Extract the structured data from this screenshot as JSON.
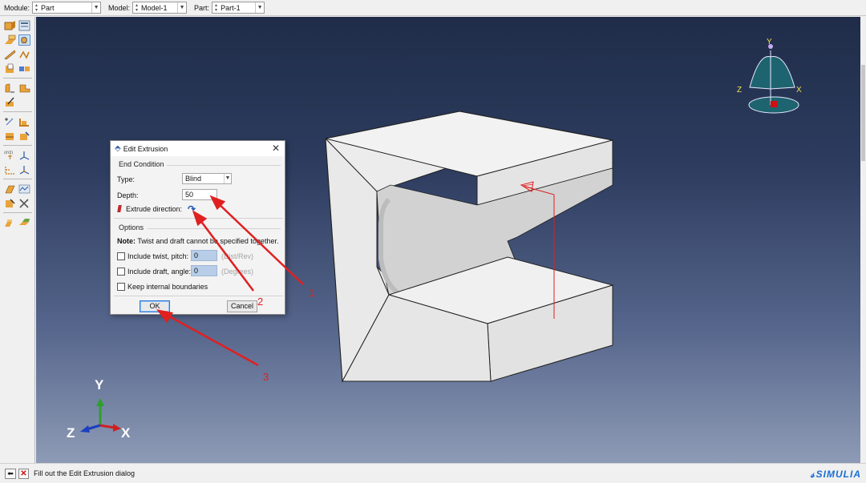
{
  "context_bar": {
    "module_label": "Module:",
    "module_value": "Part",
    "model_label": "Model:",
    "model_value": "Model-1",
    "part_label": "Part:",
    "part_value": "Part-1"
  },
  "dialog": {
    "title": "Edit Extrusion",
    "end_condition_group": "End Condition",
    "type_label": "Type:",
    "type_value": "Blind",
    "depth_label": "Depth:",
    "depth_value": "50",
    "extrude_direction_label": "Extrude direction:",
    "options_group": "Options",
    "note_bold": "Note:",
    "note_text": "Twist and draft cannot be specified together.",
    "twist_label": "Include twist, pitch:",
    "twist_value": "0",
    "twist_unit": "(Dist/Rev)",
    "draft_label": "Include draft, angle:",
    "draft_value": "0",
    "draft_unit": "(Degrees)",
    "keep_boundaries_label": "Keep internal boundaries",
    "ok_label": "OK",
    "cancel_label": "Cancel"
  },
  "triad_top": {
    "y": "Y",
    "x": "X",
    "z": "Z"
  },
  "triad_bottom": {
    "y": "Y",
    "x": "X",
    "z": "Z"
  },
  "annotations": [
    "1",
    "2",
    "3"
  ],
  "status": {
    "prompt": "Fill out the Edit Extrusion dialog"
  },
  "brand": {
    "name": "SIMULIA"
  },
  "colors": {
    "annotation_red": "#e02020",
    "viewport_top": "#1f2c49",
    "viewport_bottom": "#8e9bb6",
    "part_light": "#e8e8e8",
    "triad_teal": "#1e6470"
  }
}
